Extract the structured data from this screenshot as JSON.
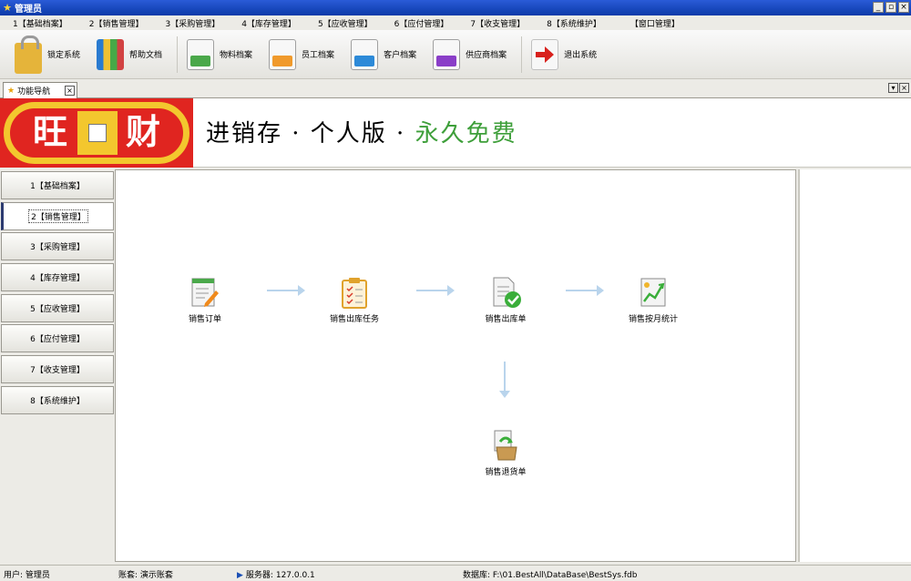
{
  "window": {
    "title": "管理员"
  },
  "menu": [
    "1【基础档案】",
    "2【销售管理】",
    "3【采购管理】",
    "4【库存管理】",
    "5【应收管理】",
    "6【应付管理】",
    "7【收支管理】",
    "8【系统维护】",
    "【窗口管理】"
  ],
  "toolbar": [
    {
      "label": "锁定系统",
      "icon": "lock-icon"
    },
    {
      "label": "帮助文档",
      "icon": "books-icon"
    },
    {
      "label": "物料档案",
      "icon": "material-archive-icon"
    },
    {
      "label": "员工档案",
      "icon": "employee-archive-icon"
    },
    {
      "label": "客户档案",
      "icon": "customer-archive-icon"
    },
    {
      "label": "供应商档案",
      "icon": "supplier-archive-icon"
    },
    {
      "label": "退出系统",
      "icon": "exit-arrow-icon"
    }
  ],
  "tab": {
    "label": "功能导航"
  },
  "banner": {
    "logo_left": "旺",
    "logo_right": "财",
    "slogan_main": "进销存 · 个人版 · ",
    "slogan_free": "永久免费"
  },
  "nav": [
    "1【基础档案】",
    "2【销售管理】",
    "3【采购管理】",
    "4【库存管理】",
    "5【应收管理】",
    "6【应付管理】",
    "7【收支管理】",
    "8【系统维护】"
  ],
  "active_nav": 1,
  "flow": {
    "order": "销售订单",
    "task": "销售出库任务",
    "outbound": "销售出库单",
    "stats": "销售按月统计",
    "return": "销售退货单"
  },
  "status": {
    "user_label": "用户:",
    "user": "管理员",
    "account_label": "账套:",
    "account": "演示账套",
    "server_label": "服务器:",
    "server": "127.0.0.1",
    "db_label": "数据库:",
    "db": "F:\\01.BestAll\\DataBase\\BestSys.fdb"
  },
  "colors": {
    "title_blue": "#0b3aa8",
    "logo_red": "#e02520",
    "logo_gold": "#f3c72e",
    "free_green": "#3e9f3a",
    "arrow": "#b9d4ec"
  }
}
